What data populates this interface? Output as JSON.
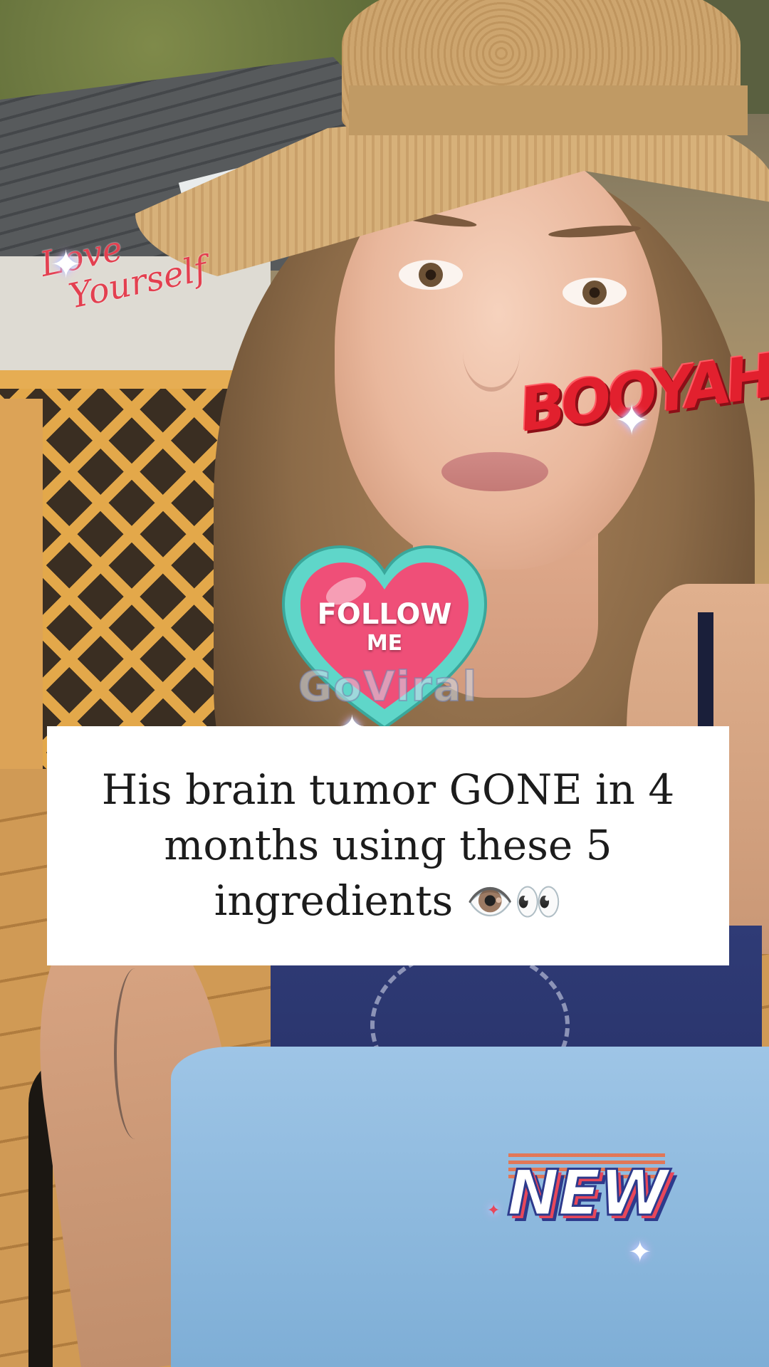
{
  "overlays": {
    "love_sticker": {
      "line1": "Love",
      "line2": "Yourself"
    },
    "booyah_sticker": {
      "text": "BOOYAH!!!"
    },
    "follow_sticker": {
      "line1": "FOLLOW",
      "line2": "ME",
      "watermark": "GoViral"
    },
    "caption": {
      "text": "His brain tumor GONE in 4 months using these 5 ingredients",
      "emoji": "👁️👀"
    },
    "new_sticker": {
      "text": "NEW"
    }
  },
  "colors": {
    "caption_bg": "#ffffff",
    "caption_text": "#1c1c1c",
    "heart_fill": "#ef4f78",
    "heart_outline": "#5fd6c9",
    "booyah_red": "#e2202e",
    "love_red": "#e34050",
    "new_blue": "#2d3a8c",
    "new_pink": "#e8475a"
  },
  "icons": [
    "sparkle-icon",
    "heart-icon",
    "eyes-emoji-icon"
  ]
}
